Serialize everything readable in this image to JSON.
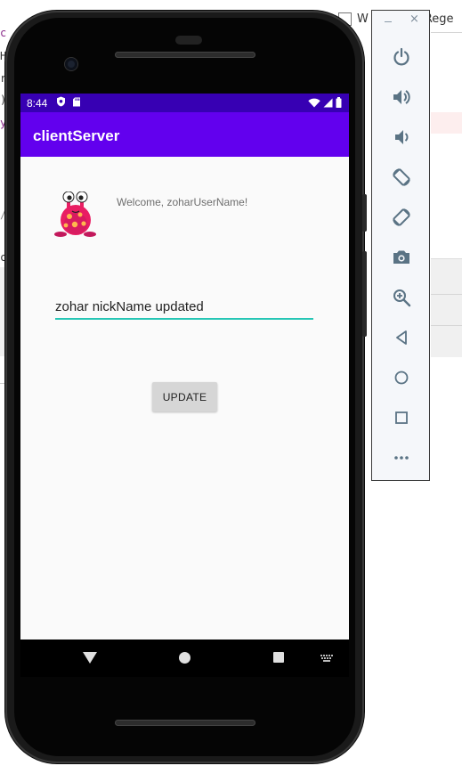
{
  "background": {
    "search_option_label": "W",
    "regex_label": "Rege",
    "code_fragments": [
      "c",
      "H",
      "r",
      ")",
      "y",
      "/",
      "c",
      ")"
    ]
  },
  "statusbar": {
    "time": "8:44",
    "icons": [
      "shield-icon",
      "sd-card-icon",
      "wifi-icon",
      "signal-icon",
      "battery-icon"
    ]
  },
  "app": {
    "title": "clientServer",
    "welcome_text": "Welcome, zoharUserName!",
    "nickname_value": "zohar nickName updated",
    "update_label": "UPDATE",
    "avatar_icon": "monster-avatar-icon"
  },
  "navbar": {
    "icons": [
      "back-icon",
      "home-icon",
      "recents-icon",
      "keyboard-icon"
    ]
  },
  "emulator_toolbar": {
    "window_controls": [
      "minimize-icon",
      "close-icon"
    ],
    "close_glyph": "×",
    "buttons": [
      {
        "name": "power-button",
        "icon": "power-icon"
      },
      {
        "name": "volume-up-button",
        "icon": "volume-up-icon"
      },
      {
        "name": "volume-down-button",
        "icon": "volume-down-icon"
      },
      {
        "name": "rotate-left-button",
        "icon": "rotate-left-icon"
      },
      {
        "name": "rotate-right-button",
        "icon": "rotate-right-icon"
      },
      {
        "name": "screenshot-button",
        "icon": "camera-icon"
      },
      {
        "name": "zoom-button",
        "icon": "zoom-icon"
      },
      {
        "name": "back-button",
        "icon": "back-icon"
      },
      {
        "name": "home-button",
        "icon": "home-icon"
      },
      {
        "name": "overview-button",
        "icon": "overview-icon"
      },
      {
        "name": "more-button",
        "icon": "more-icon"
      }
    ]
  },
  "colors": {
    "status_bar": "#3700b3",
    "app_bar": "#6200ee",
    "input_underline": "#26c6b5",
    "toolbar_icon": "#5a7384"
  }
}
